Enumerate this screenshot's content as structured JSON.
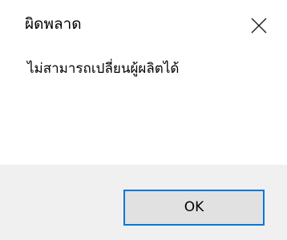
{
  "dialog": {
    "title": "ผิดพลาด",
    "message": "ไม่สามารถเปลี่ยนผู้ผลิตได้",
    "ok_label": "OK"
  },
  "icons": {
    "close": "close-icon"
  },
  "colors": {
    "background": "#ffffff",
    "footer": "#f0f0f0",
    "button_face": "#e1e1e1",
    "button_focus_border": "#0078d7"
  }
}
